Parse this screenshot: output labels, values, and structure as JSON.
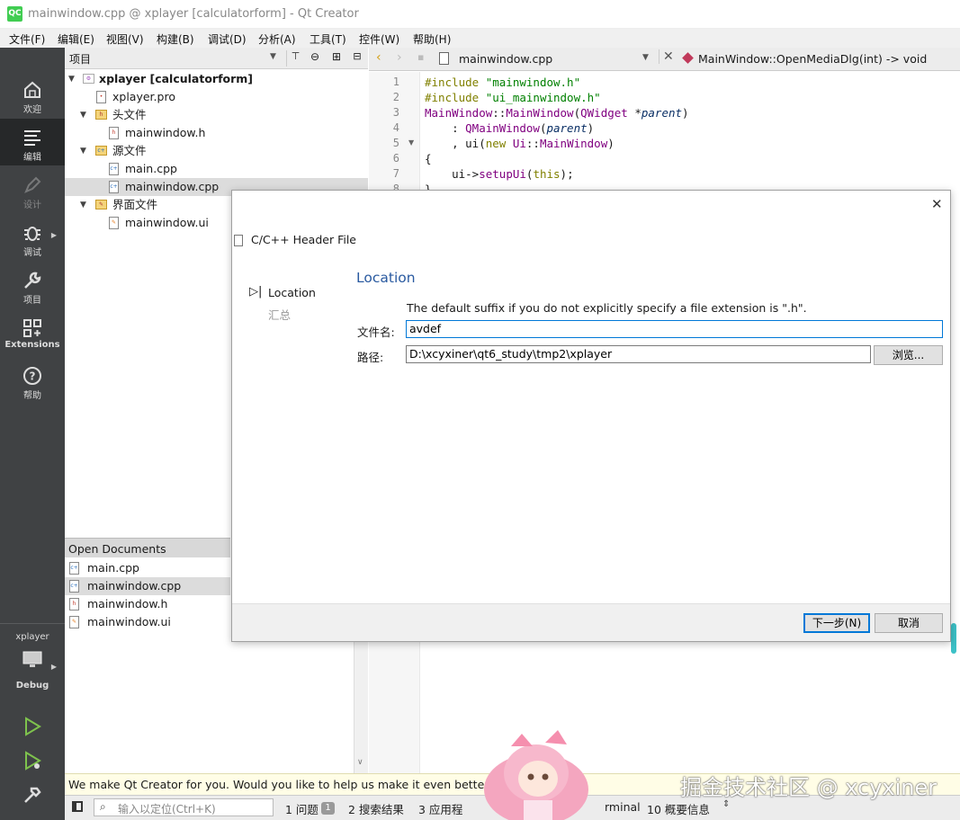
{
  "window": {
    "title": "mainwindow.cpp @ xplayer [calculatorform] - Qt Creator",
    "logo": "QC"
  },
  "menu": [
    "文件(F)",
    "编辑(E)",
    "视图(V)",
    "构建(B)",
    "调试(D)",
    "分析(A)",
    "工具(T)",
    "控件(W)",
    "帮助(H)"
  ],
  "modes": {
    "welcome": "欢迎",
    "edit": "编辑",
    "design": "设计",
    "debug": "调试",
    "projects": "项目",
    "extensions": "Extensions",
    "help": "帮助"
  },
  "kit": {
    "project": "xplayer",
    "build": "Debug"
  },
  "project_pane": {
    "title": "项目",
    "tree": [
      {
        "label": "xplayer [calculatorform]",
        "bold": true
      },
      {
        "label": "xplayer.pro"
      },
      {
        "label": "头文件"
      },
      {
        "label": "mainwindow.h"
      },
      {
        "label": "源文件"
      },
      {
        "label": "main.cpp"
      },
      {
        "label": "mainwindow.cpp"
      },
      {
        "label": "界面文件"
      },
      {
        "label": "mainwindow.ui"
      }
    ]
  },
  "open_documents": {
    "title": "Open Documents",
    "items": [
      "main.cpp",
      "mainwindow.cpp",
      "mainwindow.h",
      "mainwindow.ui"
    ]
  },
  "editor": {
    "file_tab": "mainwindow.cpp",
    "symbol": "MainWindow::OpenMediaDlg(int) -> void",
    "line_numbers": [
      "1",
      "2",
      "3",
      "4",
      "5",
      "6",
      "7",
      "8"
    ]
  },
  "dialog": {
    "header": "C/C++ Header File",
    "steps": [
      "Location",
      "汇总"
    ],
    "section_title": "Location",
    "description": "The default suffix if you do not explicitly specify a file extension is \".h\".",
    "filename_label": "文件名:",
    "filename_value": "avdef",
    "path_label": "路径:",
    "path_value": "D:\\xcyxiner\\qt6_study\\tmp2\\xplayer",
    "browse_button": "浏览...",
    "next_button": "下一步(N)",
    "cancel_button": "取消"
  },
  "infobar": {
    "message": "We make Qt Creator for you. Would you like to help us make it even better?"
  },
  "statusbar": {
    "locator_placeholder": "输入以定位(Ctrl+K)",
    "issues": "1 问题",
    "issues_count": "1",
    "search": "2 搜索结果",
    "app_output": "3 应用程",
    "terminal": "rminal",
    "general": "10 概要信息"
  },
  "watermark": "掘金技术社区 @ xcyxiner"
}
